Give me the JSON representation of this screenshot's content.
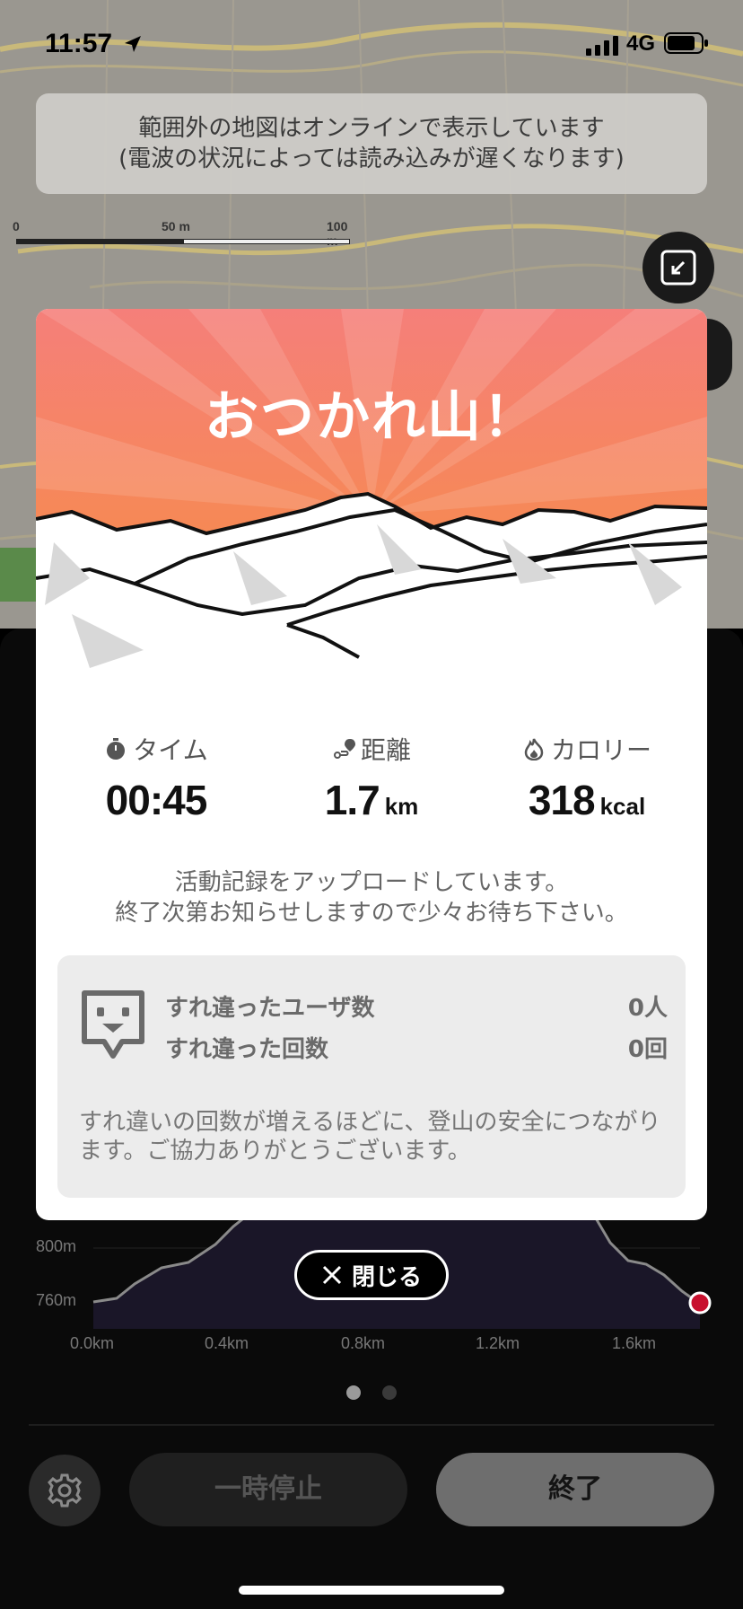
{
  "status_bar": {
    "time": "11:57",
    "network": "4G"
  },
  "map": {
    "notice_line1": "範囲外の地図はオンラインで表示しています",
    "notice_line2": "(電波の状況によっては読み込みが遅くなります)",
    "scale_labels": [
      "0",
      "50 m",
      "100 m"
    ]
  },
  "modal": {
    "title": "おつかれ山！",
    "stats": {
      "time": {
        "label": "タイム",
        "value": "00:45",
        "unit": ""
      },
      "distance": {
        "label": "距離",
        "value": "1.7",
        "unit": "km"
      },
      "calories": {
        "label": "カロリー",
        "value": "318",
        "unit": "kcal"
      }
    },
    "upload_line1": "活動記録をアップロードしています。",
    "upload_line2": "終了次第お知らせしますので少々お待ち下さい。",
    "encounter": {
      "users_label": "すれ違ったユーザ数",
      "users_value": "0人",
      "count_label": "すれ違った回数",
      "count_value": "0回",
      "note": "すれ違いの回数が増えるほどに、登山の安全につながります。ご協力ありがとうございます。"
    },
    "close_label": "閉じる"
  },
  "elevation_chart": {
    "y_ticks": [
      "800m",
      "760m"
    ],
    "x_ticks": [
      "0.0km",
      "0.4km",
      "0.8km",
      "1.2km",
      "1.6km"
    ]
  },
  "controls": {
    "pause_label": "一時停止",
    "end_label": "終了"
  },
  "colors": {
    "hero_top": "#f57f7a",
    "hero_bottom": "#f7903a",
    "sheet_bg": "#0a0a0a",
    "end_button": "#6e6e6e",
    "marker": "#c8102e"
  },
  "pager": {
    "pages": 2,
    "active": 1
  }
}
